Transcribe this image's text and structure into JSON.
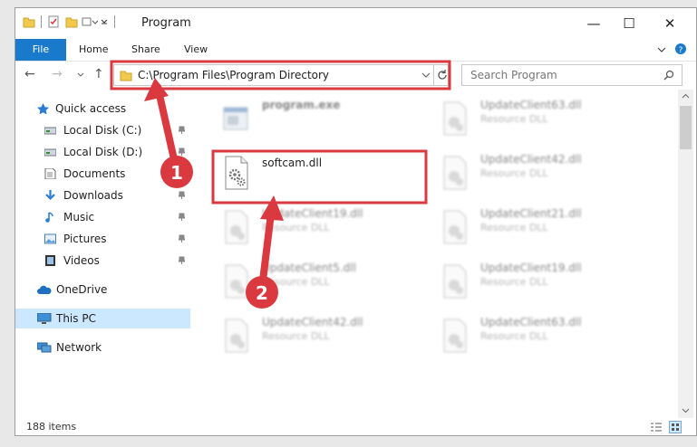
{
  "window": {
    "title": "Program",
    "controls": {
      "minimize": "—",
      "maximize": "☐",
      "close": "✕"
    }
  },
  "ribbon": {
    "tabs": [
      "File",
      "Home",
      "Share",
      "View"
    ],
    "expand_icon": "chevron-down-icon",
    "help_icon": "question-icon"
  },
  "address": {
    "path": "C:\\Program Files\\Program Directory",
    "search_placeholder": "Search Program"
  },
  "nav": {
    "items": [
      {
        "label": "Quick access",
        "icon": "star-icon",
        "pinned": false
      },
      {
        "label": "Local Disk (C:)",
        "icon": "drive-icon",
        "pinned": true
      },
      {
        "label": "Local Disk (D:)",
        "icon": "drive-icon",
        "pinned": true
      },
      {
        "label": "Documents",
        "icon": "document-icon",
        "pinned": true
      },
      {
        "label": "Downloads",
        "icon": "download-icon",
        "pinned": true
      },
      {
        "label": "Music",
        "icon": "music-icon",
        "pinned": true
      },
      {
        "label": "Pictures",
        "icon": "pictures-icon",
        "pinned": true
      },
      {
        "label": "Videos",
        "icon": "videos-icon",
        "pinned": true
      },
      {
        "label": "OneDrive",
        "icon": "cloud-icon",
        "pinned": false
      },
      {
        "label": "This PC",
        "icon": "computer-icon",
        "pinned": false,
        "selected": true
      },
      {
        "label": "Network",
        "icon": "network-icon",
        "pinned": false
      }
    ]
  },
  "files": [
    {
      "name": "program.exe",
      "desc": "",
      "highlighted": false
    },
    {
      "name": "UpdateClient63.dll",
      "desc": "Resource DLL",
      "highlighted": false
    },
    {
      "name": "softcam.dll",
      "desc": "",
      "highlighted": true
    },
    {
      "name": "UpdateClient42.dll",
      "desc": "Resource DLL",
      "highlighted": false
    },
    {
      "name": "UpdateClient19.dll",
      "desc": "Resource DLL",
      "highlighted": false
    },
    {
      "name": "UpdateClient21.dll",
      "desc": "Resource DLL",
      "highlighted": false
    },
    {
      "name": "UpdateClient5.dll",
      "desc": "Resource DLL",
      "highlighted": false
    },
    {
      "name": "UpdateClient19.dll",
      "desc": "Resource DLL",
      "highlighted": false
    },
    {
      "name": "UpdateClient42.dll",
      "desc": "Resource DLL",
      "highlighted": false
    },
    {
      "name": "UpdateClient63.dll",
      "desc": "Resource DLL",
      "highlighted": false
    }
  ],
  "status": {
    "item_count": "188 items"
  },
  "annotations": {
    "step1": "1",
    "step2": "2",
    "highlight_color": "#d9393f"
  },
  "colors": {
    "accent": "#1979ca",
    "selection": "#cce8ff"
  }
}
